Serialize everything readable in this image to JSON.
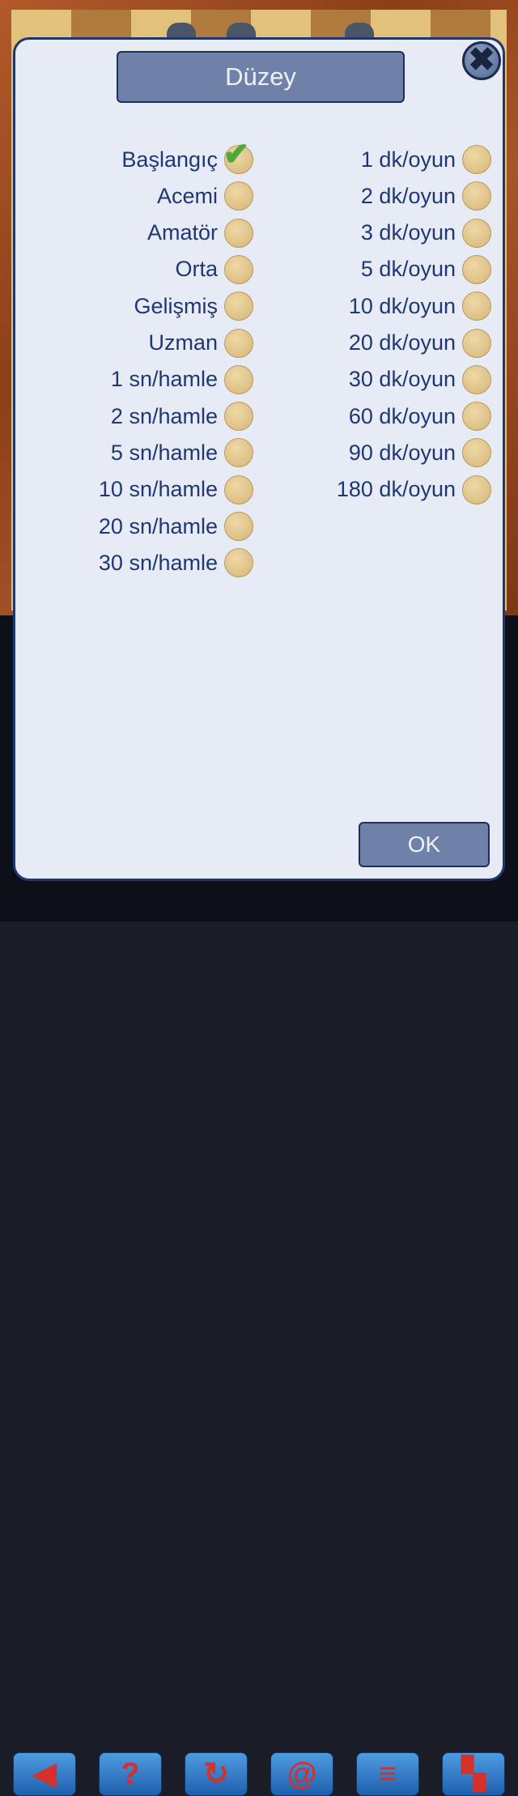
{
  "dialog": {
    "title": "Düzey",
    "ok_label": "OK",
    "close_icon": "close-icon"
  },
  "levels_left": [
    {
      "label": "Başlangıç",
      "selected": true
    },
    {
      "label": "Acemi",
      "selected": false
    },
    {
      "label": "Amatör",
      "selected": false
    },
    {
      "label": "Orta",
      "selected": false
    },
    {
      "label": "Gelişmiş",
      "selected": false
    },
    {
      "label": "Uzman",
      "selected": false
    },
    {
      "label": "1 sn/hamle",
      "selected": false
    },
    {
      "label": "2 sn/hamle",
      "selected": false
    },
    {
      "label": "5 sn/hamle",
      "selected": false
    },
    {
      "label": "10 sn/hamle",
      "selected": false
    },
    {
      "label": "20 sn/hamle",
      "selected": false
    },
    {
      "label": "30 sn/hamle",
      "selected": false
    }
  ],
  "levels_right": [
    {
      "label": "1 dk/oyun",
      "selected": false
    },
    {
      "label": "2 dk/oyun",
      "selected": false
    },
    {
      "label": "3 dk/oyun",
      "selected": false
    },
    {
      "label": "5 dk/oyun",
      "selected": false
    },
    {
      "label": "10 dk/oyun",
      "selected": false
    },
    {
      "label": "20 dk/oyun",
      "selected": false
    },
    {
      "label": "30 dk/oyun",
      "selected": false
    },
    {
      "label": "60 dk/oyun",
      "selected": false
    },
    {
      "label": "90 dk/oyun",
      "selected": false
    },
    {
      "label": "180 dk/oyun",
      "selected": false
    }
  ],
  "toolbar": {
    "icons": [
      "back-arrow-icon",
      "help-icon",
      "rotate-icon",
      "spiral-icon",
      "menu-icon",
      "exit-icon"
    ]
  },
  "colors": {
    "dialog_bg": "#e6ebf5",
    "title_bg": "#6f81a8",
    "text": "#1f3773",
    "radio": "#d5b677",
    "check": "#4aab3a"
  }
}
